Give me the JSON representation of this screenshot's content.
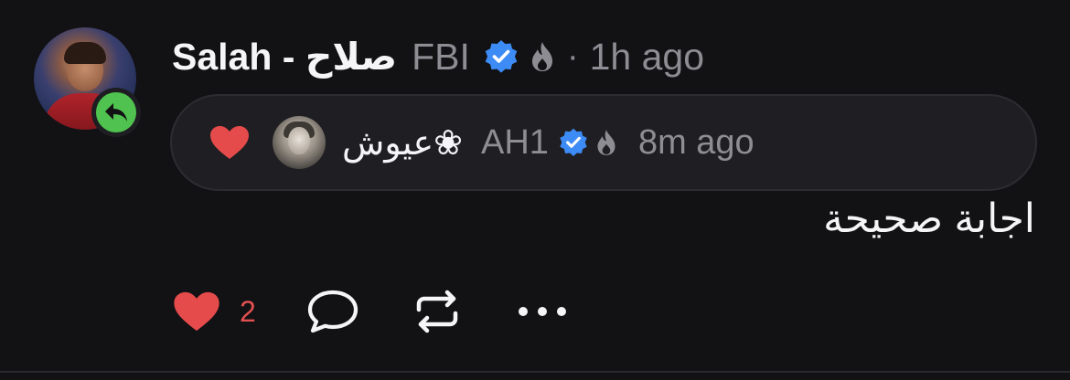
{
  "post": {
    "author": {
      "name": "Salah - صلاح",
      "handle": "FBI",
      "verified": true,
      "badge_icon": "fire-icon"
    },
    "separator": "·",
    "time": "1h ago",
    "reply_indicator_icon": "reply-arrow-icon",
    "quote": {
      "reaction_icon": "heart-icon",
      "author": {
        "name": "عيوش❀",
        "handle": "AH1",
        "verified": true,
        "badge_icon": "fire-icon"
      },
      "time": "8m ago"
    },
    "text": "اجابة صحيحة",
    "actions": {
      "like_icon": "heart-icon",
      "like_count": "2",
      "comment_icon": "comment-bubble-icon",
      "repost_icon": "repost-icon",
      "more_icon": "more-dots-icon"
    }
  },
  "colors": {
    "background": "#121114",
    "pill_background": "#1f1e22",
    "text_primary": "#f5f5f7",
    "text_secondary": "#8e8d93",
    "verified_blue": "#3d8bf5",
    "like_red": "#e54b4b",
    "reply_badge_green": "#4fc24f"
  }
}
